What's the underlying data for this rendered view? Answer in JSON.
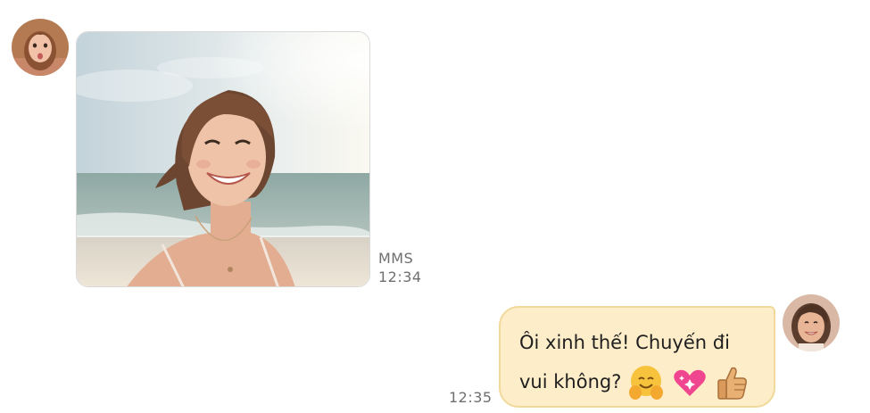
{
  "conversation": {
    "incoming": {
      "attachment_type": "MMS",
      "time": "12:34",
      "avatar_icon": "contact-avatar",
      "photo_icon": "beach-selfie-photo"
    },
    "outgoing": {
      "text_line1": "Ôi xinh thế! Chuyến đi",
      "text_line2": "vui không?",
      "emojis": [
        "hugging-face-emoji",
        "sparkling-heart-emoji",
        "thumbs-up-emoji"
      ],
      "time": "12:35",
      "avatar_icon": "my-avatar"
    }
  },
  "colors": {
    "outgoing_bubble": "#fdedc9",
    "outgoing_border": "#f1d99b",
    "meta_text": "#6f6f6f"
  }
}
